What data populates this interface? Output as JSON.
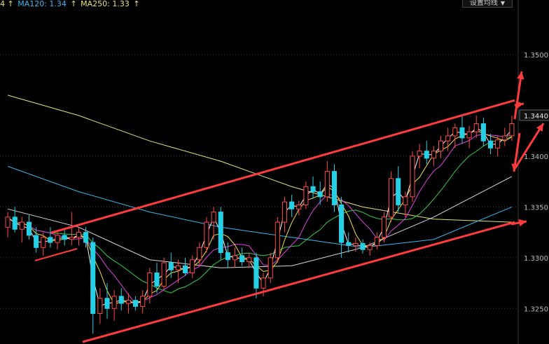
{
  "legend": {
    "lead_text": "4 ↑",
    "ma120_text": "MA120: 1.34",
    "ma120_arrow": "↑",
    "ma250_text": "MA250: 1.33",
    "ma250_arrow": "↑"
  },
  "controls": {
    "ma_settings_label": "设置均线",
    "caret": "▼"
  },
  "colors": {
    "background": "#000000",
    "grid": "#3a3a3a",
    "candle_up": "#ff4a4a",
    "candle_down": "#25d0e6",
    "trendline": "#ff3b3b",
    "ma_short": "#f5f5f5",
    "ma_yellow": "#f0e040",
    "ma_magenta": "#e040e0",
    "ma_green": "#30d050",
    "ma_white": "#d8d8d8",
    "ma120": "#37b8ee",
    "ma250": "#e8e17a"
  },
  "chart_data": {
    "type": "candlestick",
    "y_axis": {
      "ticks": [
        "1.3500",
        "1.3400",
        "1.3350",
        "1.3300",
        "1.3250"
      ],
      "current_price_label": "1.3440",
      "ylim": [
        1.3215,
        1.354
      ]
    },
    "candles_ohlc": [
      [
        1.333,
        1.3345,
        1.332,
        1.334
      ],
      [
        1.334,
        1.335,
        1.3325,
        1.3328
      ],
      [
        1.3328,
        1.334,
        1.3315,
        1.3335
      ],
      [
        1.3335,
        1.3342,
        1.3318,
        1.3322
      ],
      [
        1.3322,
        1.333,
        1.3305,
        1.331
      ],
      [
        1.331,
        1.3325,
        1.3302,
        1.332
      ],
      [
        1.332,
        1.333,
        1.331,
        1.3315
      ],
      [
        1.3315,
        1.3325,
        1.3308,
        1.3322
      ],
      [
        1.3322,
        1.3328,
        1.3312,
        1.3318
      ],
      [
        1.3318,
        1.3345,
        1.3312,
        1.332
      ],
      [
        1.332,
        1.333,
        1.3312,
        1.3325
      ],
      [
        1.3325,
        1.333,
        1.331,
        1.3315
      ],
      [
        1.3315,
        1.332,
        1.3225,
        1.3245
      ],
      [
        1.3245,
        1.327,
        1.3235,
        1.326
      ],
      [
        1.326,
        1.3275,
        1.324,
        1.325
      ],
      [
        1.325,
        1.3268,
        1.3238,
        1.3262
      ],
      [
        1.3262,
        1.327,
        1.3248,
        1.3255
      ],
      [
        1.3255,
        1.3265,
        1.3245,
        1.3258
      ],
      [
        1.3258,
        1.3262,
        1.3248,
        1.3252
      ],
      [
        1.3252,
        1.3268,
        1.3245,
        1.3262
      ],
      [
        1.3262,
        1.329,
        1.3255,
        1.3285
      ],
      [
        1.3285,
        1.3295,
        1.3265,
        1.3272
      ],
      [
        1.3272,
        1.33,
        1.3268,
        1.3295
      ],
      [
        1.3295,
        1.3305,
        1.328,
        1.3288
      ],
      [
        1.3288,
        1.3298,
        1.3275,
        1.3292
      ],
      [
        1.3292,
        1.33,
        1.3282,
        1.3285
      ],
      [
        1.3285,
        1.3302,
        1.328,
        1.3298
      ],
      [
        1.3298,
        1.3315,
        1.3292,
        1.331
      ],
      [
        1.331,
        1.334,
        1.3305,
        1.3335
      ],
      [
        1.3335,
        1.335,
        1.3318,
        1.3345
      ],
      [
        1.3345,
        1.335,
        1.3298,
        1.3305
      ],
      [
        1.3305,
        1.3315,
        1.329,
        1.3298
      ],
      [
        1.3298,
        1.331,
        1.329,
        1.3302
      ],
      [
        1.3302,
        1.331,
        1.3292,
        1.3296
      ],
      [
        1.3296,
        1.3305,
        1.329,
        1.33
      ],
      [
        1.33,
        1.3305,
        1.326,
        1.327
      ],
      [
        1.327,
        1.3285,
        1.3262,
        1.328
      ],
      [
        1.328,
        1.3305,
        1.3275,
        1.33
      ],
      [
        1.33,
        1.334,
        1.3295,
        1.3335
      ],
      [
        1.3335,
        1.336,
        1.3325,
        1.3355
      ],
      [
        1.3355,
        1.3362,
        1.334,
        1.3348
      ],
      [
        1.3348,
        1.3356,
        1.3342,
        1.3352
      ],
      [
        1.3352,
        1.3375,
        1.3348,
        1.337
      ],
      [
        1.337,
        1.338,
        1.3358,
        1.3365
      ],
      [
        1.3365,
        1.3375,
        1.3352,
        1.336
      ],
      [
        1.336,
        1.3395,
        1.3355,
        1.3385
      ],
      [
        1.3385,
        1.3392,
        1.3345,
        1.3352
      ],
      [
        1.3352,
        1.336,
        1.33,
        1.3315
      ],
      [
        1.3315,
        1.3325,
        1.3305,
        1.3312
      ],
      [
        1.3312,
        1.332,
        1.3306,
        1.3314
      ],
      [
        1.3314,
        1.3318,
        1.3304,
        1.3308
      ],
      [
        1.3308,
        1.3315,
        1.3302,
        1.3312
      ],
      [
        1.3312,
        1.3325,
        1.3308,
        1.332
      ],
      [
        1.332,
        1.3345,
        1.3315,
        1.334
      ],
      [
        1.334,
        1.3385,
        1.3335,
        1.3378
      ],
      [
        1.3378,
        1.339,
        1.3345,
        1.3352
      ],
      [
        1.3352,
        1.3365,
        1.334,
        1.336
      ],
      [
        1.336,
        1.3405,
        1.3355,
        1.34
      ],
      [
        1.34,
        1.3412,
        1.3388,
        1.3405
      ],
      [
        1.3405,
        1.3415,
        1.3392,
        1.3398
      ],
      [
        1.3398,
        1.341,
        1.339,
        1.3405
      ],
      [
        1.3405,
        1.342,
        1.3398,
        1.3415
      ],
      [
        1.3415,
        1.3428,
        1.3405,
        1.342
      ],
      [
        1.342,
        1.3432,
        1.3408,
        1.3428
      ],
      [
        1.3428,
        1.344,
        1.3412,
        1.3418
      ],
      [
        1.3418,
        1.343,
        1.3408,
        1.3424
      ],
      [
        1.3424,
        1.344,
        1.3418,
        1.3432
      ],
      [
        1.3432,
        1.3438,
        1.341,
        1.3415
      ],
      [
        1.3415,
        1.3422,
        1.3402,
        1.3408
      ],
      [
        1.3408,
        1.342,
        1.34,
        1.3416
      ],
      [
        1.3416,
        1.3428,
        1.341,
        1.342
      ],
      [
        1.342,
        1.344,
        1.3415,
        1.3432
      ]
    ],
    "moving_averages": [
      {
        "name": "MA120",
        "value": 1.34,
        "color_key": "ma120"
      },
      {
        "name": "MA250",
        "value": 1.33,
        "color_key": "ma250"
      }
    ],
    "ma120_path": [
      [
        0,
        1.339
      ],
      [
        10,
        1.3365
      ],
      [
        20,
        1.3345
      ],
      [
        30,
        1.333
      ],
      [
        40,
        1.332
      ],
      [
        50,
        1.331
      ],
      [
        60,
        1.3318
      ],
      [
        71,
        1.335
      ]
    ],
    "ma250_path": [
      [
        0,
        1.346
      ],
      [
        10,
        1.344
      ],
      [
        20,
        1.3415
      ],
      [
        30,
        1.3395
      ],
      [
        40,
        1.337
      ],
      [
        50,
        1.335
      ],
      [
        60,
        1.3338
      ],
      [
        71,
        1.3335
      ]
    ],
    "ma_white_path": [
      [
        0,
        1.3348
      ],
      [
        10,
        1.333
      ],
      [
        20,
        1.3298
      ],
      [
        30,
        1.329
      ],
      [
        40,
        1.3292
      ],
      [
        50,
        1.331
      ],
      [
        60,
        1.334
      ],
      [
        71,
        1.338
      ]
    ],
    "trend_channel": {
      "upper": [
        [
          12,
          1.333
        ],
        [
          71,
          1.3455
        ]
      ],
      "lower": [
        [
          12,
          1.3215
        ],
        [
          71,
          1.3335
        ]
      ]
    }
  }
}
